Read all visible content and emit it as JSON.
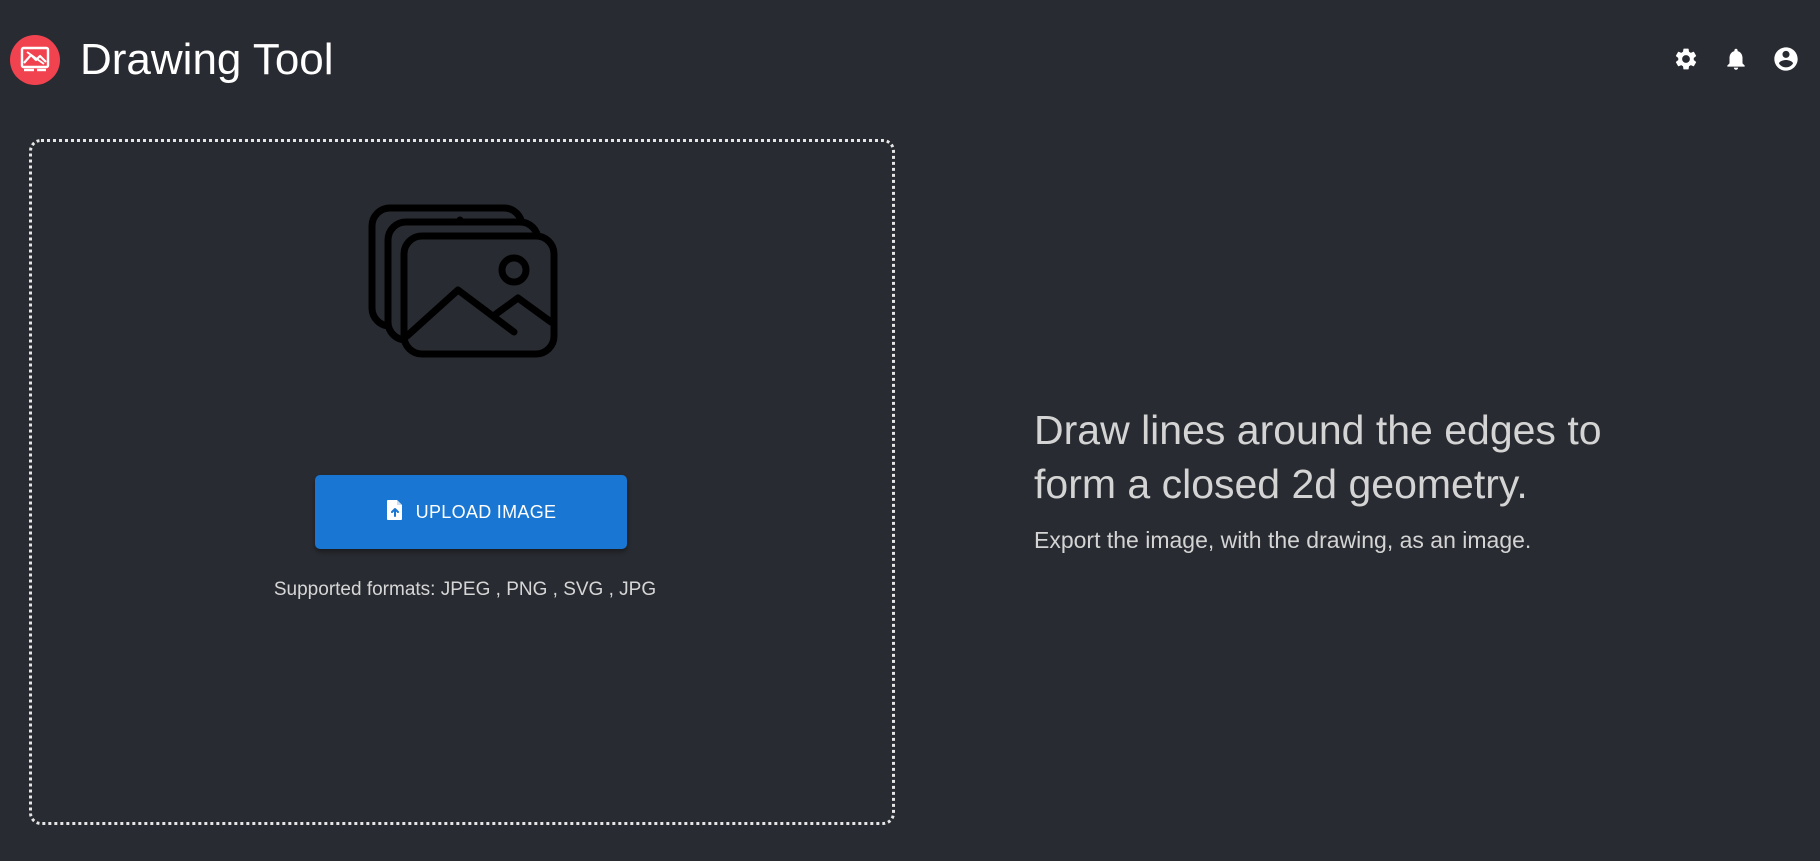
{
  "header": {
    "title": "Drawing Tool",
    "logo_icon": "drawing-tool-logo-icon",
    "logo_color": "#f0434f",
    "icons": [
      "gear-icon",
      "bell-icon",
      "account-circle-icon"
    ]
  },
  "dropzone": {
    "illustration_icon": "image-stack-icon",
    "upload_button_label": "UPLOAD IMAGE",
    "upload_button_icon": "file-upload-icon",
    "upload_button_color": "#1976d2",
    "formats_text": "Supported formats: JPEG , PNG , SVG , JPG"
  },
  "info": {
    "headline": "Draw lines around the edges to form a closed 2d geometry.",
    "subtext": "Export the image, with the drawing, as an image."
  },
  "theme": {
    "background": "#282b31"
  }
}
